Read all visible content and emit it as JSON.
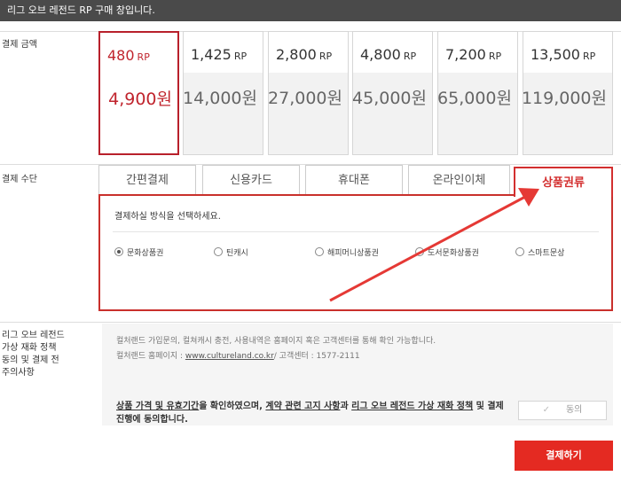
{
  "header": {
    "notice": "리그 오브 레전드 RP 구매 창입니다."
  },
  "sections": {
    "amount_label": "결제 금액",
    "method_label": "결제 수단",
    "policy_label_lines": [
      "리그 오브 레전드",
      "가상 재화 정책",
      "동의 및 결제 전",
      "주의사항"
    ]
  },
  "price_options": [
    {
      "rp": "480",
      "unit": "RP",
      "won": "4,900원",
      "selected": true
    },
    {
      "rp": "1,425",
      "unit": "RP",
      "won": "14,000원",
      "selected": false
    },
    {
      "rp": "2,800",
      "unit": "RP",
      "won": "27,000원",
      "selected": false
    },
    {
      "rp": "4,800",
      "unit": "RP",
      "won": "45,000원",
      "selected": false
    },
    {
      "rp": "7,200",
      "unit": "RP",
      "won": "65,000원",
      "selected": false
    },
    {
      "rp": "13,500",
      "unit": "RP",
      "won": "119,000원",
      "selected": false
    }
  ],
  "payment_tabs": [
    {
      "label": "간편결제",
      "active": false
    },
    {
      "label": "신용카드",
      "active": false
    },
    {
      "label": "휴대폰",
      "active": false
    },
    {
      "label": "온라인이체",
      "active": false
    },
    {
      "label": "상품권류",
      "active": true
    }
  ],
  "voucher_panel": {
    "prompt": "결제하실 방식을 선택하세요.",
    "options": [
      {
        "label": "문화상품권",
        "selected": true
      },
      {
        "label": "틴캐시",
        "selected": false
      },
      {
        "label": "해피머니상품권",
        "selected": false
      },
      {
        "label": "도서문화상품권",
        "selected": false
      },
      {
        "label": "스마트문상",
        "selected": false
      }
    ]
  },
  "notice": {
    "line1": "컬처랜드 가입문의, 컬쳐캐시 충전, 사용내역은 홈페이지 혹은 고객센터를 통해 확인 가능합니다.",
    "homepage_label": "컬처랜드 홈페이지 : ",
    "homepage_link": "www.cultureland.co.kr",
    "service_center": "/ 고객센터 : 1577-2111"
  },
  "agreement": {
    "part1": "상품 가격 및 유효기간",
    "part2": "을 확인하였으며, ",
    "part3": "계약 관련 고지 사항",
    "part4": "과 ",
    "part5": "리그 오브 레전드 가상 재화 정책",
    "part6": " 및 결제 진행에 동의합니다.",
    "button_label": "동의"
  },
  "pay_button_label": "결제하기",
  "colors": {
    "accent": "#d32f2f",
    "pay_button": "#e42a22",
    "header_bg": "#4a4a4a"
  }
}
